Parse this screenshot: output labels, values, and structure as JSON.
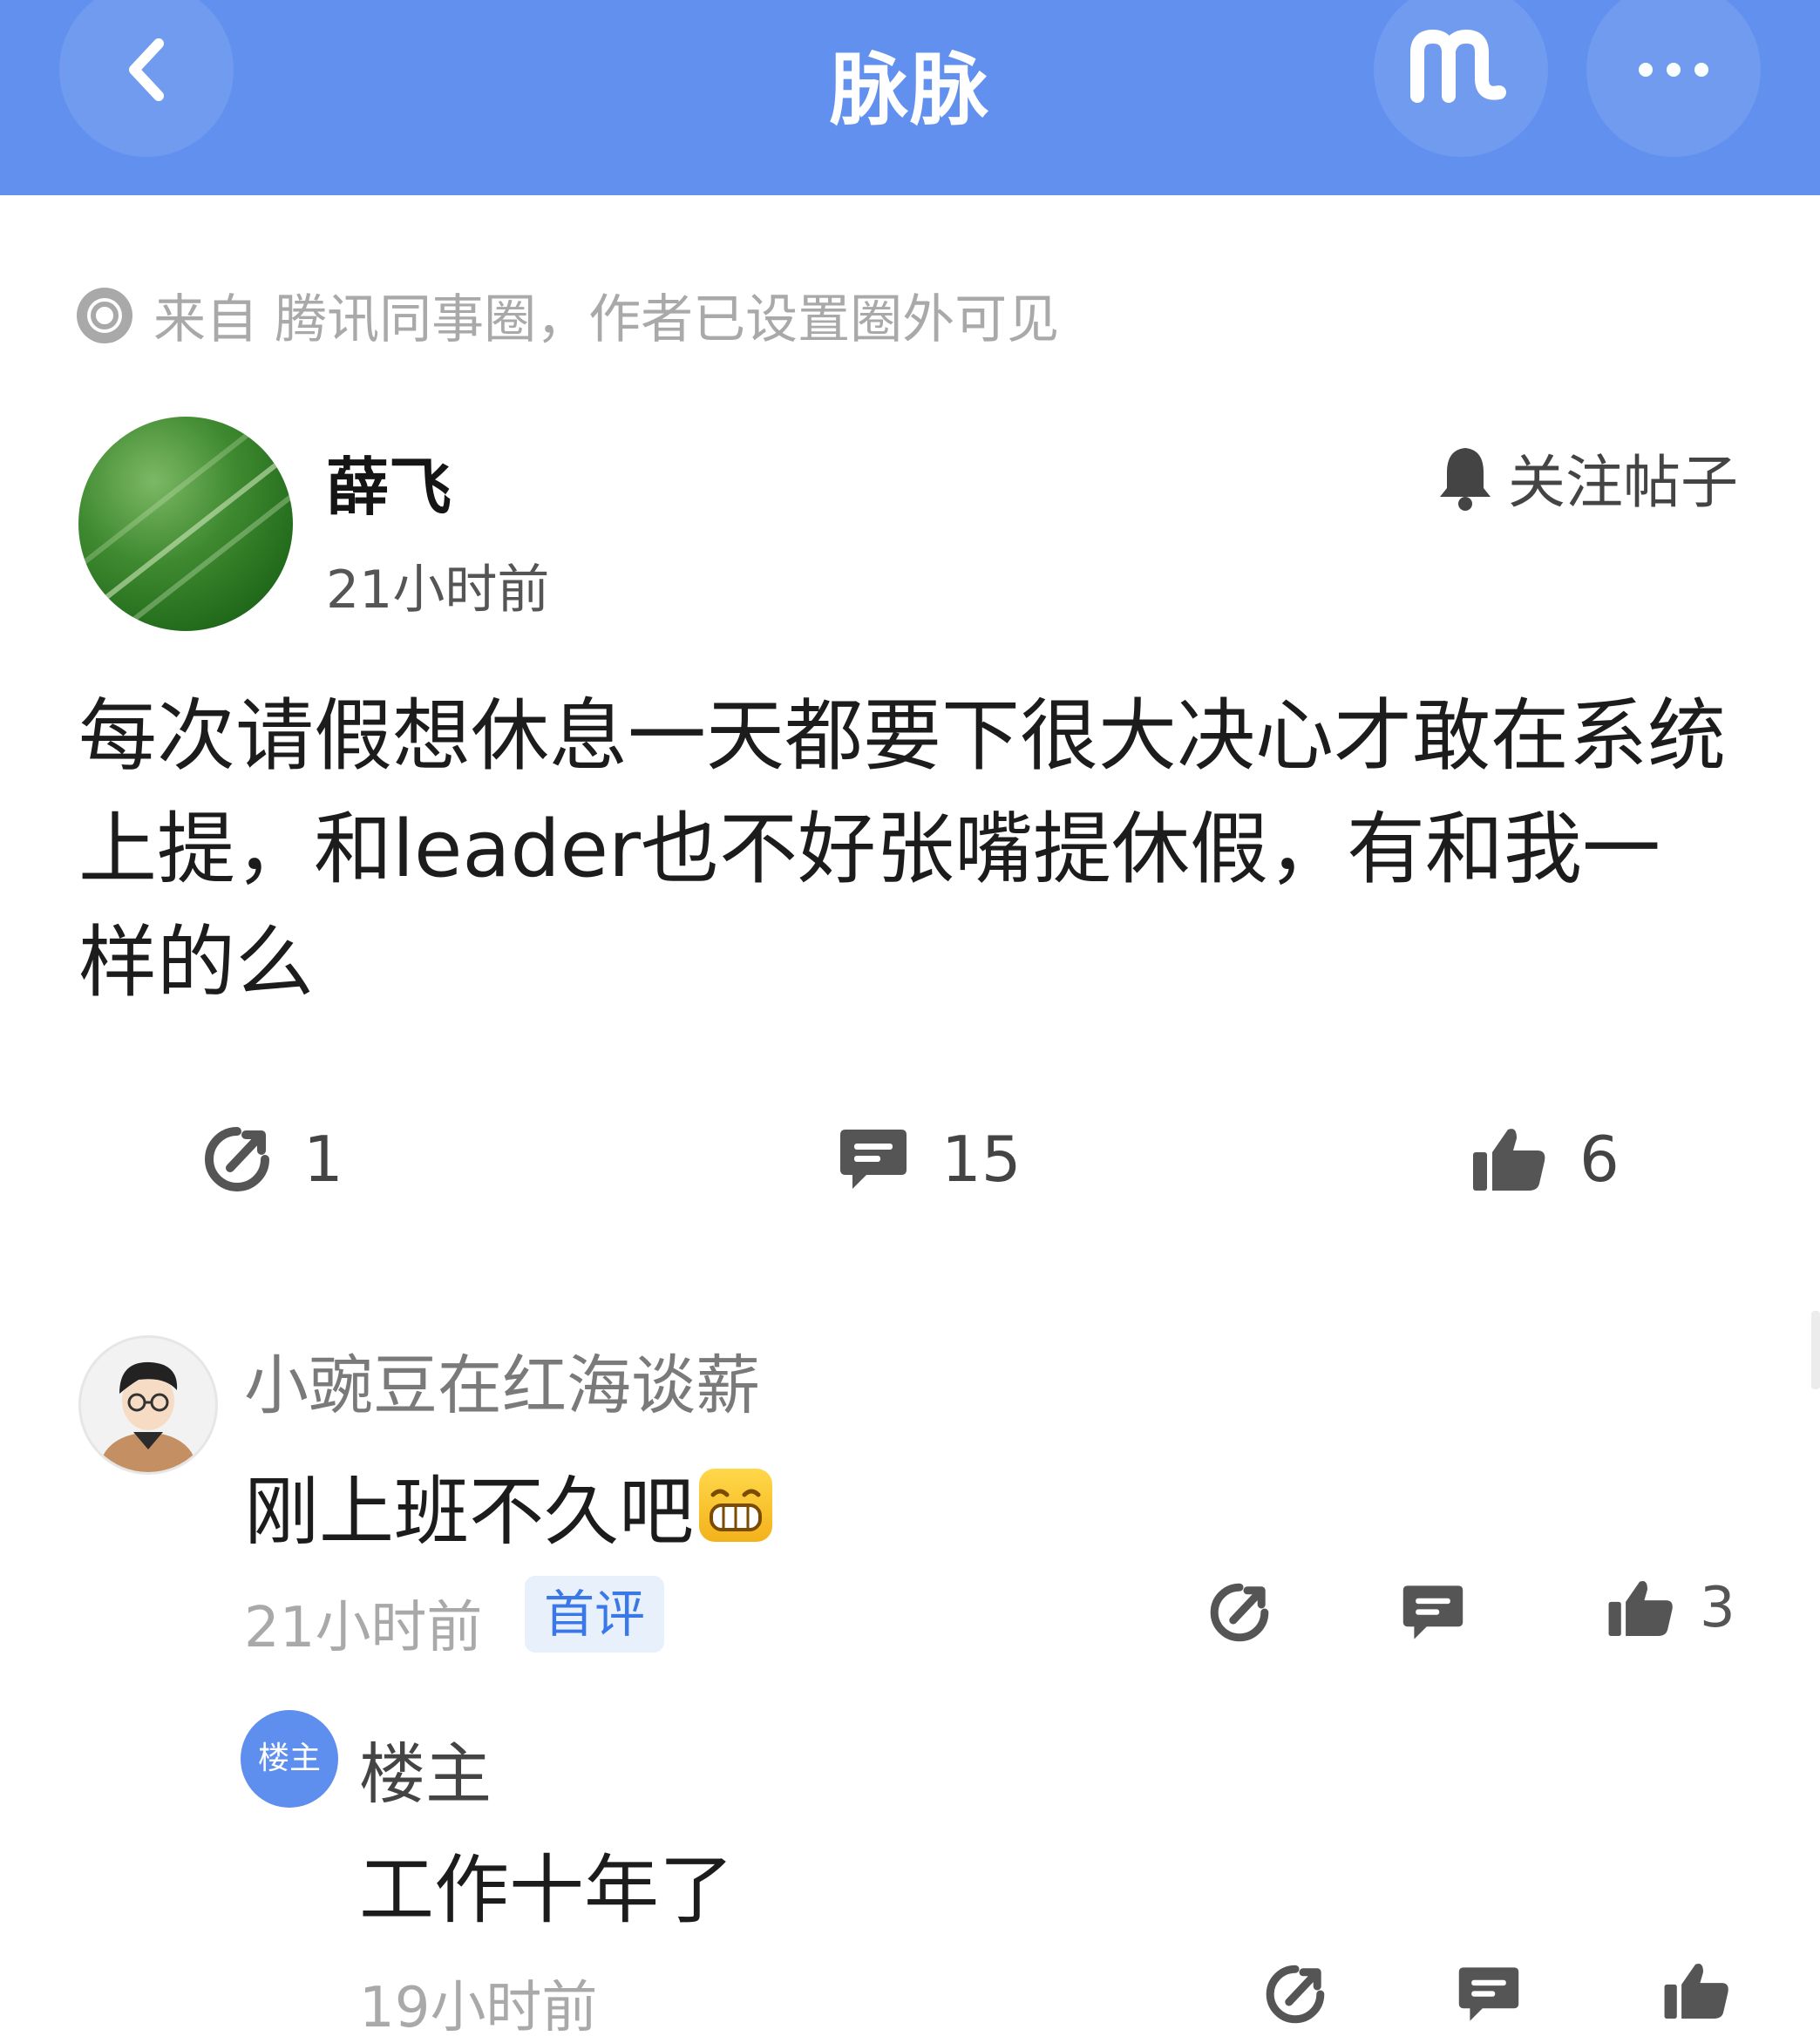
{
  "header": {
    "title": "脉脉",
    "back_icon": "chevron-left-icon",
    "logo_icon": "maimai-logo-icon",
    "more_icon": "ellipsis-icon"
  },
  "source_notice": {
    "text": "来自 腾讯同事圈，作者已设置圈外可见"
  },
  "post": {
    "author_name": "薛飞",
    "time": "21小时前",
    "follow_label": "关注帖子",
    "content": "每次请假想休息一天都要下很大决心才敢在系统上提，和leader也不好张嘴提休假，有和我一样的么",
    "actions": {
      "share_count": "1",
      "comment_count": "15",
      "like_count": "6"
    }
  },
  "comments": [
    {
      "name": "小豌豆在红海谈薪",
      "text": "刚上班不久吧",
      "time": "21小时前",
      "badge": "首评",
      "like_count": "3",
      "replies": [
        {
          "badge": "楼主",
          "name": "楼主",
          "text": "工作十年了",
          "time": "19小时前"
        }
      ]
    }
  ],
  "colors": {
    "header_bg": "#6190ee",
    "badge_bg": "#e8f0fc",
    "badge_text": "#3b78e7",
    "op_badge_bg": "#5f8fee"
  }
}
